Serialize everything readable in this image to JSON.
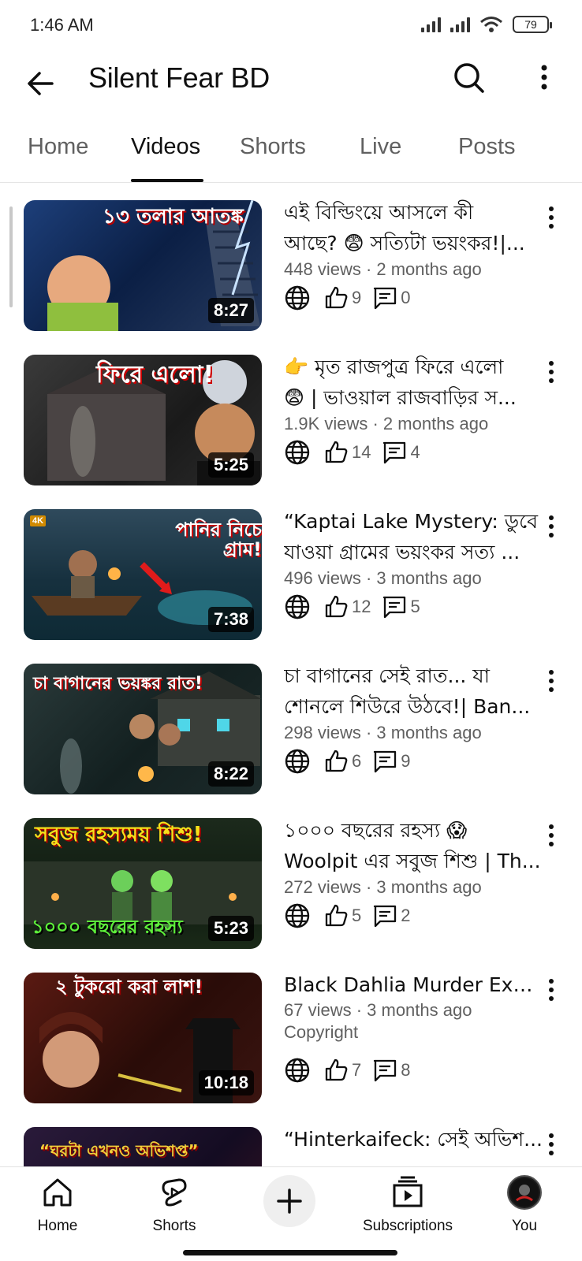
{
  "status_bar": {
    "time": "1:46 AM",
    "battery": "79"
  },
  "header": {
    "channel_name": "Silent Fear BD"
  },
  "tabs": [
    {
      "label": "Home"
    },
    {
      "label": "Videos"
    },
    {
      "label": "Shorts"
    },
    {
      "label": "Live"
    },
    {
      "label": "Posts"
    }
  ],
  "active_tab": "Videos",
  "videos": [
    {
      "title_line1": "এই বিল্ডিংয়ে আসলে কী",
      "title_line2": "আছে? 😨 সত্যিটা ভয়ংকর!|...",
      "meta": "448 views · 2 months ago",
      "likes": "9",
      "comments": "0",
      "duration": "8:27",
      "thumb_text": "১৩ তলার আতঙ্ক"
    },
    {
      "title_line1": "👉 মৃত রাজপুত্র ফিরে এলো",
      "title_line2": "😨 | ভাওয়াল রাজবাড়ির স...",
      "meta": "1.9K views · 2 months ago",
      "likes": "14",
      "comments": "4",
      "duration": "5:25",
      "thumb_text": "ফিরে এলো!"
    },
    {
      "title_line1": "“Kaptai Lake Mystery: ডুবে",
      "title_line2": "যাওয়া গ্রামের ভয়ংকর সত্য ...",
      "meta": "496 views · 3 months ago",
      "likes": "12",
      "comments": "5",
      "duration": "7:38",
      "thumb_text": "পানির নিচে গ্রাম!"
    },
    {
      "title_line1": "চা বাগানের সেই রাত... যা",
      "title_line2": "শোনলে শিউরে উঠবে!| Ban...",
      "meta": "298 views · 3 months ago",
      "likes": "6",
      "comments": "9",
      "duration": "8:22",
      "thumb_text": "চা বাগানের ভয়ঙ্কর রাত!"
    },
    {
      "title_line1": "১০০০ বছরের রহস্য 😱",
      "title_line2": "Woolpit এর সবুজ শিশু | Th...",
      "meta": "272 views · 3 months ago",
      "likes": "5",
      "comments": "2",
      "duration": "5:23",
      "thumb_text": "সবুজ রহস্যময় শিশু!"
    },
    {
      "title_line1": "Black Dahlia Murder Expl...",
      "title_line2": "",
      "meta": "67 views · 3 months ago",
      "meta2": "Copyright",
      "likes": "7",
      "comments": "8",
      "duration": "10:18",
      "thumb_text": "২ টুকরো করা লাশ!"
    },
    {
      "title_line1": "“Hinterkaifeck: সেই অভিশ...",
      "title_line2": "",
      "meta": "",
      "likes": "",
      "comments": "",
      "duration": "",
      "thumb_text": "“ঘরটা এখনও অভিশপ্ত”"
    }
  ],
  "bottom_nav": [
    {
      "label": "Home"
    },
    {
      "label": "Shorts"
    },
    {
      "label": "Subscriptions"
    },
    {
      "label": "You"
    }
  ]
}
